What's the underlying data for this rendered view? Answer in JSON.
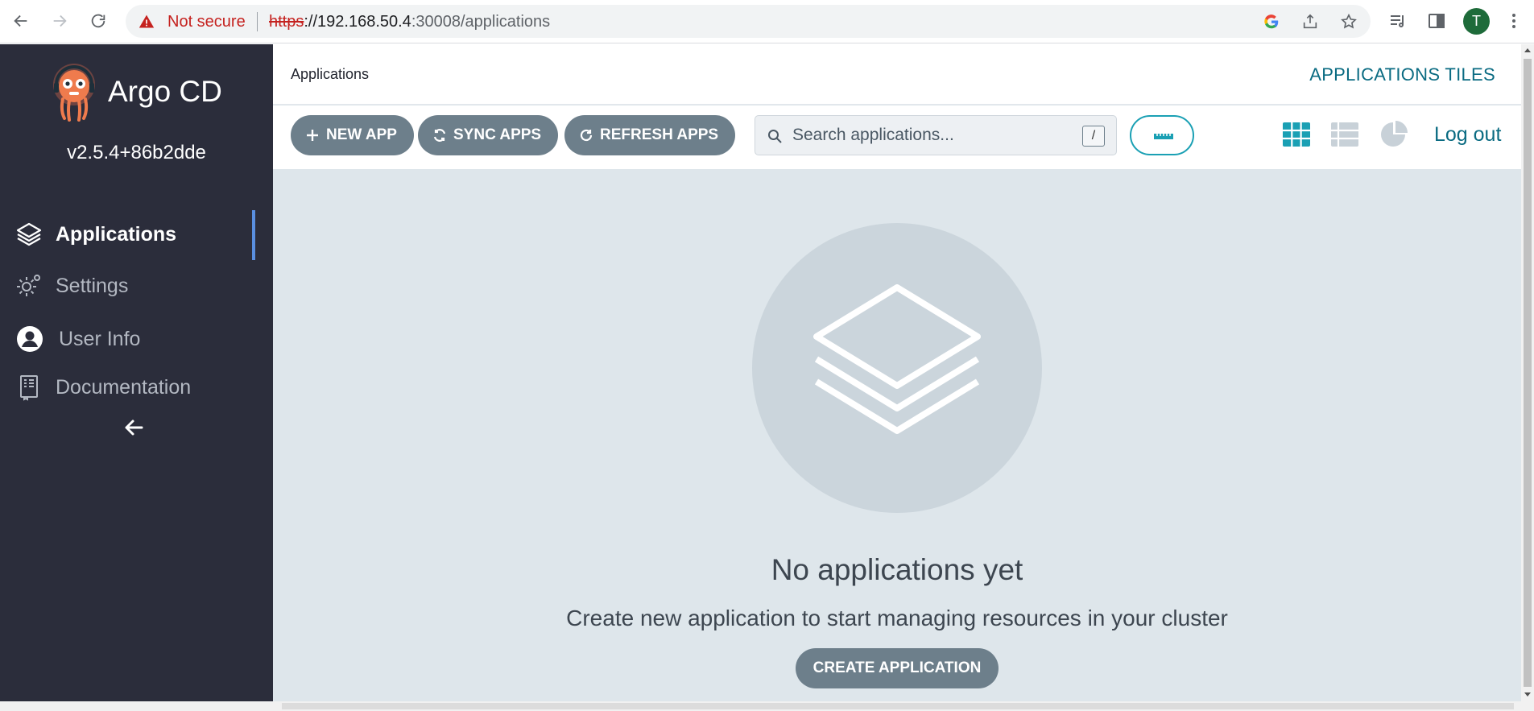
{
  "browser": {
    "security_label": "Not secure",
    "url_scheme": "https",
    "url_host": "://192.168.50.4",
    "url_path": ":30008/applications",
    "avatar_letter": "T"
  },
  "sidebar": {
    "brand": "Argo CD",
    "version": "v2.5.4+86b2dde",
    "items": [
      {
        "label": "Applications",
        "icon": "layers-icon",
        "active": true
      },
      {
        "label": "Settings",
        "icon": "gear-icon",
        "active": false
      },
      {
        "label": "User Info",
        "icon": "user-icon",
        "active": false
      },
      {
        "label": "Documentation",
        "icon": "book-icon",
        "active": false
      }
    ]
  },
  "header": {
    "breadcrumb": "Applications",
    "title": "APPLICATIONS TILES"
  },
  "toolbar": {
    "new_app": "NEW APP",
    "sync_apps": "SYNC APPS",
    "refresh_apps": "REFRESH APPS",
    "search_placeholder": "Search applications...",
    "search_shortcut": "/",
    "logout": "Log out"
  },
  "empty_state": {
    "title": "No applications yet",
    "subtitle": "Create new application to start managing resources in your cluster",
    "button": "CREATE APPLICATION"
  },
  "colors": {
    "sidebar_bg": "#2b2d3b",
    "accent": "#0a6b82",
    "button_bg": "#6d7f8b",
    "active_view": "#1aa0b4",
    "main_bg": "#dee6eb"
  }
}
